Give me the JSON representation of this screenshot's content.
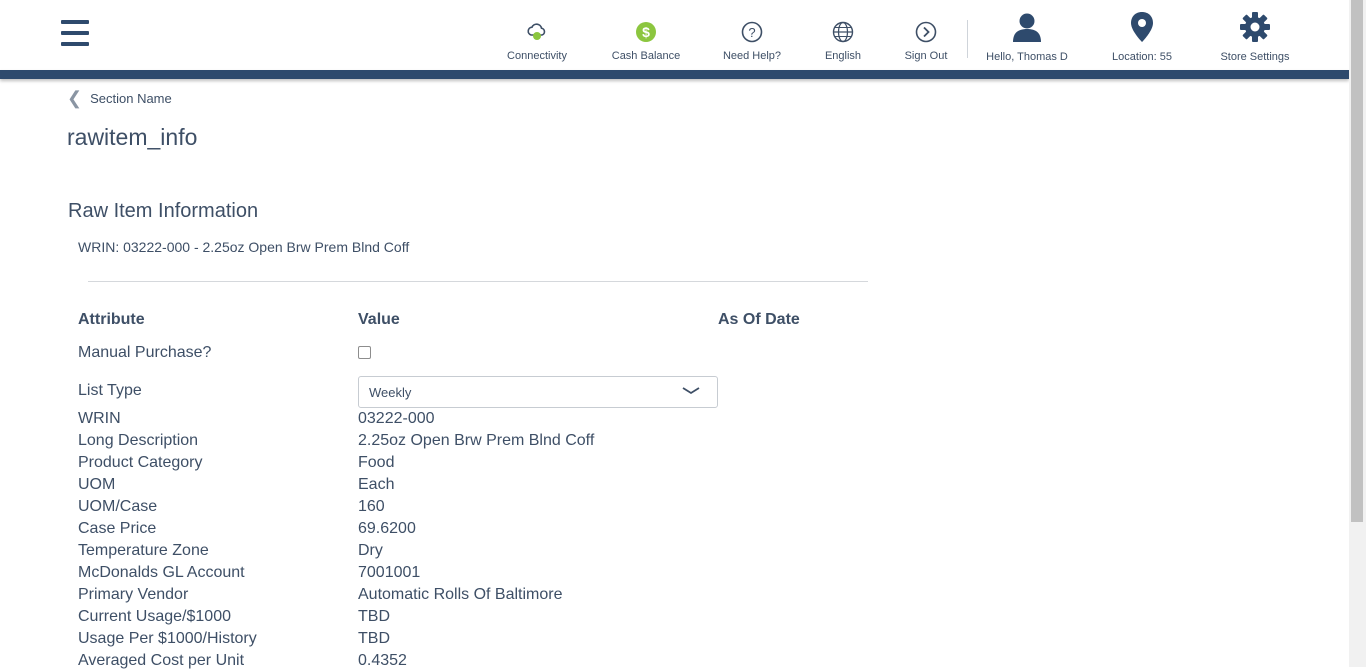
{
  "header": {
    "nav": {
      "connectivity": "Connectivity",
      "cash_balance": "Cash Balance",
      "need_help": "Need Help?",
      "language": "English",
      "sign_out": "Sign Out",
      "user": "Hello, Thomas D",
      "location": "Location: 55",
      "store_settings": "Store Settings"
    }
  },
  "breadcrumb": {
    "label": "Section Name"
  },
  "page": {
    "title": "rawitem_info",
    "section_title": "Raw Item Information",
    "wrin_line": "WRIN: 03222-000 - 2.25oz Open Brw Prem Blnd Coff"
  },
  "table": {
    "headers": {
      "attribute": "Attribute",
      "value": "Value",
      "as_of_date": "As Of Date"
    },
    "manual_purchase_label": "Manual Purchase?",
    "manual_purchase_checked": false,
    "list_type_label": "List Type",
    "list_type_value": "Weekly",
    "rows": [
      {
        "label": "WRIN",
        "value": "03222-000"
      },
      {
        "label": "Long Description",
        "value": "2.25oz Open Brw Prem Blnd Coff"
      },
      {
        "label": "Product Category",
        "value": "Food"
      },
      {
        "label": "UOM",
        "value": "Each"
      },
      {
        "label": "UOM/Case",
        "value": "160"
      },
      {
        "label": "Case Price",
        "value": "69.6200"
      },
      {
        "label": "Temperature Zone",
        "value": "Dry"
      },
      {
        "label": "McDonalds GL Account",
        "value": "7001001"
      },
      {
        "label": "Primary Vendor",
        "value": "Automatic Rolls Of Baltimore"
      },
      {
        "label": "Current Usage/$1000",
        "value": "TBD"
      },
      {
        "label": "Usage Per $1000/History",
        "value": "TBD"
      },
      {
        "label": "Averaged Cost per Unit",
        "value": "0.4352"
      }
    ]
  },
  "colors": {
    "primary": "#2e4a6d",
    "text": "#3e4f66",
    "cash_green": "#8cc63f"
  }
}
